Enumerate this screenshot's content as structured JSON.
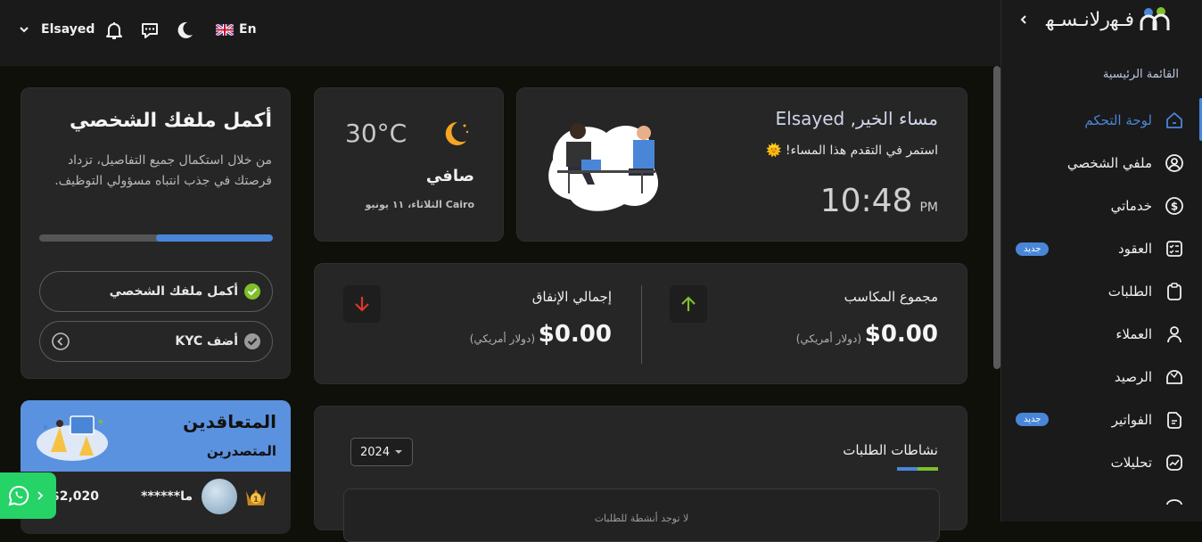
{
  "topbar": {
    "user_name": "Elsayed",
    "language": "En"
  },
  "brand": {
    "logo_text": "فـﮭرلانـسـﮭ"
  },
  "sidebar": {
    "section_title": "القائمة الرئيسية",
    "items": [
      {
        "label": "لوحة التحكم",
        "icon": "home-icon",
        "active": true
      },
      {
        "label": "ملفي الشخصي",
        "icon": "user-circle-icon"
      },
      {
        "label": "خدماتي",
        "icon": "dollar-circle-icon"
      },
      {
        "label": "العقود",
        "icon": "contract-icon",
        "badge": "جديد"
      },
      {
        "label": "الطلبات",
        "icon": "clipboard-icon"
      },
      {
        "label": "العملاء",
        "icon": "person-icon"
      },
      {
        "label": "الرصيد",
        "icon": "wallet-icon"
      },
      {
        "label": "الفواتير",
        "icon": "invoice-icon",
        "badge": "جديد"
      },
      {
        "label": "تحليلات",
        "icon": "analytics-icon"
      }
    ]
  },
  "greeting": {
    "title": "مساء الخير, Elsayed",
    "subtitle": "استمر في التقدم هذا المساء!",
    "sun_emoji": "🌞",
    "time": "10:48",
    "period": "PM"
  },
  "weather": {
    "temperature": "30°C",
    "condition": "صافي",
    "location_date": "Cairo الثلاثاء، ١١ يونيو"
  },
  "stats": {
    "earnings_label": "مجموع المكاسب",
    "earnings_value": "$0.00",
    "earnings_currency": "(دولار أمريكي)",
    "spending_label": "إجمالي الإنفاق",
    "spending_value": "$0.00",
    "spending_currency": "(دولار أمريكي)"
  },
  "activity": {
    "title": "نشاطات الطلبات",
    "year": "2024",
    "empty_text": "لا توجد أنشطة للطلبات"
  },
  "profile": {
    "title": "أكمل ملفك الشخصي",
    "description": "من خلال استكمال جميع التفاصيل، تزداد فرصتك في جذب انتباه مسؤولي التوظيف.",
    "progress": 0.5,
    "tasks": [
      {
        "label": "أكمل ملفك الشخصي",
        "done": true
      },
      {
        "label": "أضف KYC",
        "done": false
      }
    ]
  },
  "top_contractors": {
    "title": "المتعاقدين",
    "subtitle": "المتصدرين",
    "entry_name": "ما******",
    "entry_amount": "$2,020"
  },
  "colors": {
    "accent": "#4a86d8",
    "success": "#7fbf2a",
    "danger": "#d93a2b",
    "sun": "#f6a623"
  }
}
